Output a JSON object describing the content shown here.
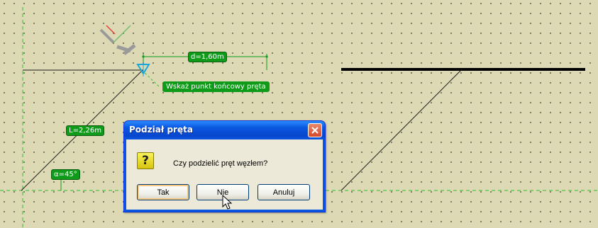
{
  "canvas": {
    "labels": {
      "distance": "d=1,60m",
      "length": "L=2,26m",
      "angle": "α=45°",
      "hint": "Wskaż punkt końcowy pręta"
    }
  },
  "dialog": {
    "title": "Podział pręta",
    "message": "Czy podzielić pręt węzłem?",
    "icon": "question-icon",
    "question_glyph": "?",
    "buttons": {
      "yes": "Tak",
      "no": "Nie",
      "cancel": "Anuluj"
    }
  },
  "colors": {
    "background": "#ddd9b4",
    "label_green": "#0f9a1a",
    "titlebar_blue": "#0a58e0",
    "close_red": "#d5472b"
  }
}
